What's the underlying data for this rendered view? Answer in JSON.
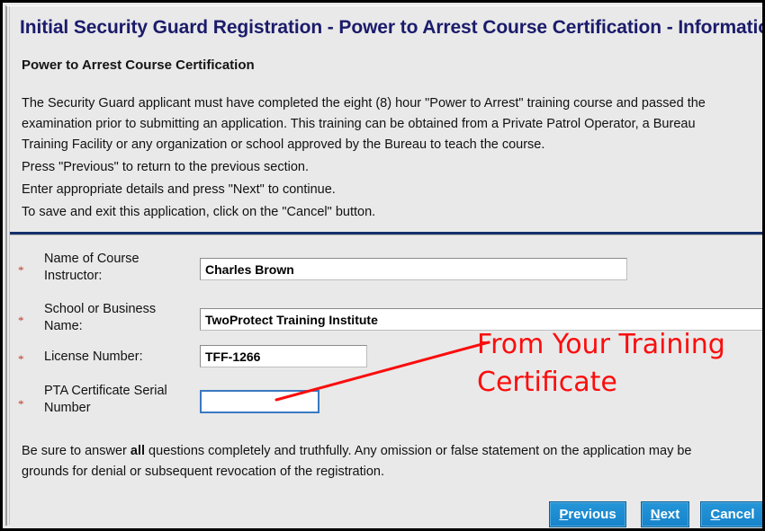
{
  "window": {
    "title": "Initial Security Guard Registration - Power to Arrest Course Certification - Information"
  },
  "page": {
    "subheading": "Power to Arrest Course Certification",
    "intro_lines": [
      "The Security Guard applicant must have completed the eight (8) hour \"Power to Arrest\" training course and passed the",
      "examination prior to submitting an application. This training can be obtained from a Private Patrol Operator, a Bureau",
      "Training Facility or any organization or school approved by the Bureau to teach the course."
    ],
    "instructions": [
      "Press \"Previous\" to return to the previous section.",
      "Enter appropriate details and press \"Next\" to continue.",
      "To save and exit this application, click on the \"Cancel\" button."
    ],
    "footer_lines": [
      {
        "before": "Be sure to answer ",
        "bold": "all",
        "after": " questions completely and truthfully. Any omission or false statement on the application may be"
      },
      {
        "before": "grounds for denial or subsequent revocation of the registration.",
        "bold": "",
        "after": ""
      }
    ]
  },
  "form": {
    "required_marker": "*",
    "fields": [
      {
        "label": "Name of Course Instructor:",
        "value": "Charles Brown",
        "placeholder": "",
        "focused": false
      },
      {
        "label": "School or Business Name:",
        "value": "TwoProtect Training Institute",
        "placeholder": "",
        "focused": false
      },
      {
        "label": "License Number:",
        "value": "TFF-1266",
        "placeholder": "",
        "focused": false
      },
      {
        "label": "PTA Certificate Serial Number",
        "value": "",
        "placeholder": "",
        "focused": true
      }
    ]
  },
  "buttons": [
    {
      "label": "Previous",
      "accesskey": "P",
      "rest": "revious"
    },
    {
      "label": "Next",
      "accesskey": "N",
      "rest": "ext"
    },
    {
      "label": "Cancel",
      "accesskey": "C",
      "rest": "ancel"
    }
  ],
  "annotation": {
    "line1": "From Your Training",
    "line2": "Certificate",
    "color": "#fb0d0d"
  },
  "colors": {
    "title_text": "#1b1b6b",
    "divider": "#14306b",
    "button_blue": "#1683cb",
    "focus_border": "#3a78c2",
    "required_star": "#c0392b",
    "panel_bg": "#e9e9e9"
  }
}
